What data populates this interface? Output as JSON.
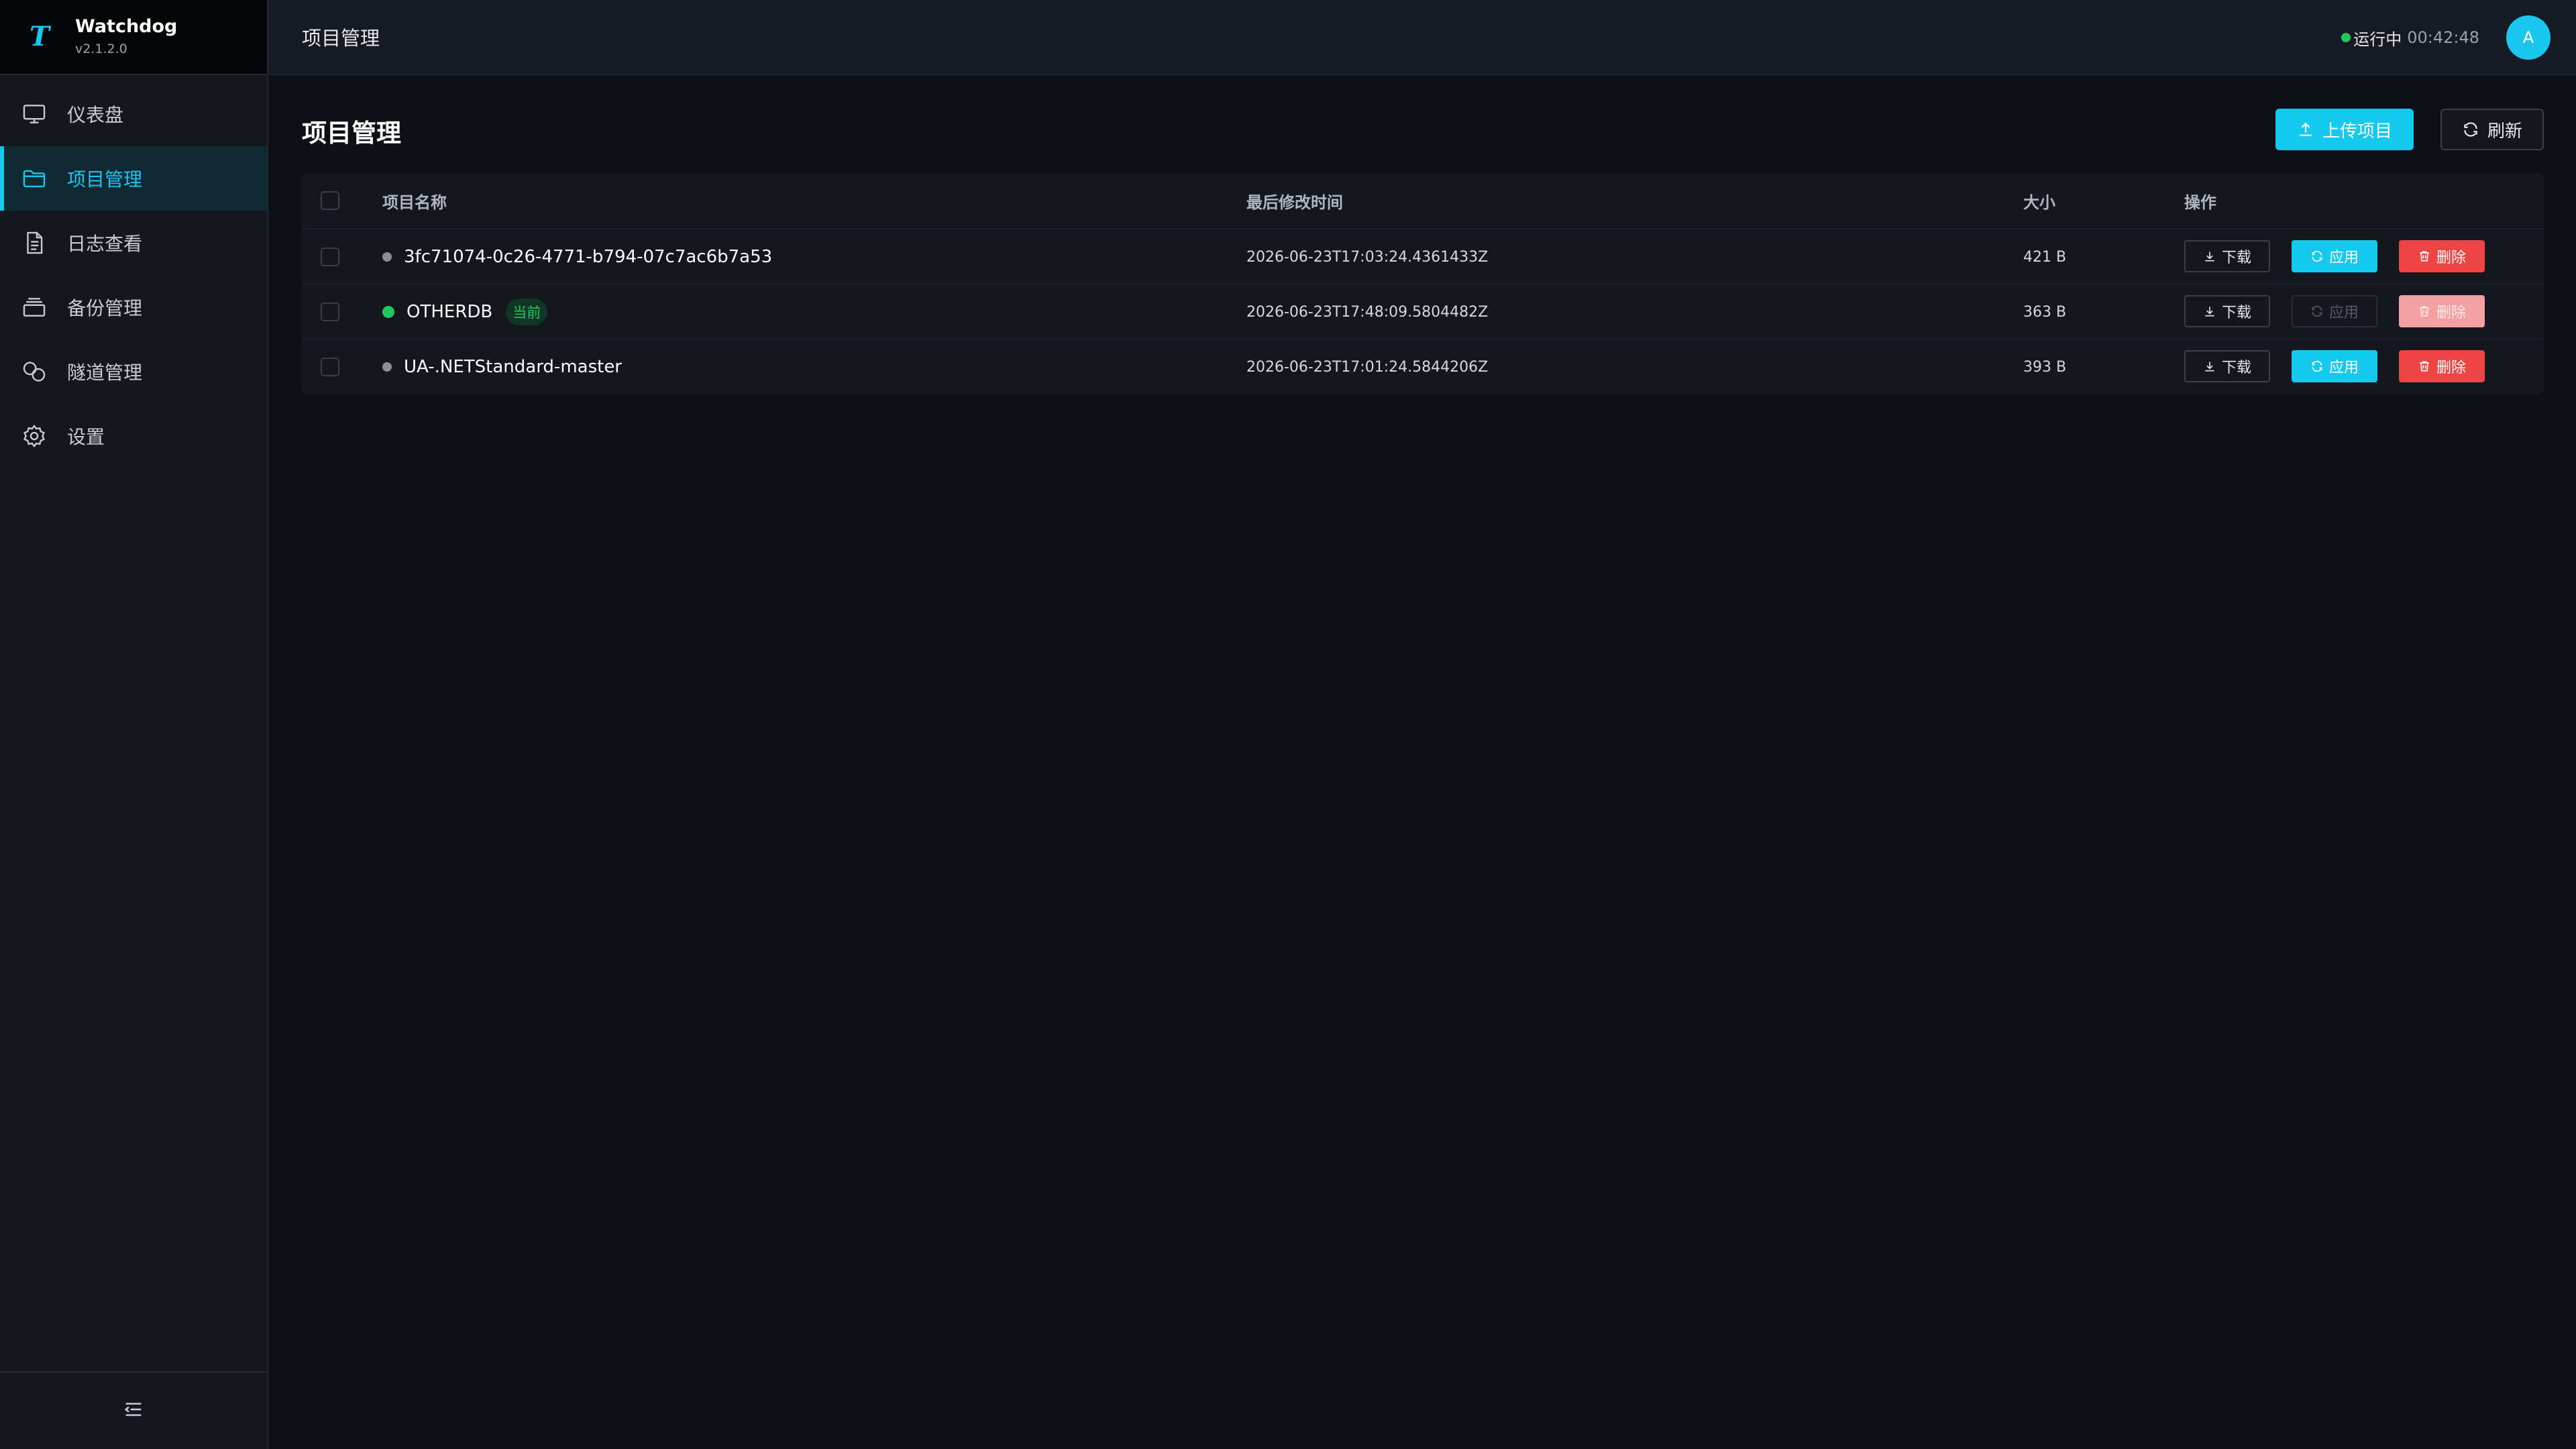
{
  "brand": {
    "name": "Watchdog",
    "version": "v2.1.2.0",
    "logo": "T"
  },
  "sidebar": {
    "items": [
      {
        "label": "仪表盘",
        "icon": "monitor-icon",
        "active": false
      },
      {
        "label": "项目管理",
        "icon": "folder-icon",
        "active": true
      },
      {
        "label": "日志查看",
        "icon": "document-icon",
        "active": false
      },
      {
        "label": "备份管理",
        "icon": "layers-icon",
        "active": false
      },
      {
        "label": "隧道管理",
        "icon": "link-icon",
        "active": false
      },
      {
        "label": "设置",
        "icon": "gear-icon",
        "active": false
      }
    ],
    "collapse_icon": "menu-fold-icon"
  },
  "topbar": {
    "title": "项目管理",
    "status": "运行中",
    "uptime": "00:42:48",
    "avatar": "A"
  },
  "page": {
    "title": "项目管理",
    "upload_label": "上传项目",
    "refresh_label": "刷新"
  },
  "table": {
    "headers": {
      "name": "项目名称",
      "modified": "最后修改时间",
      "size": "大小",
      "actions": "操作"
    },
    "rows": [
      {
        "name": "3fc71074-0c26-4771-b794-07c7ac6b7a53",
        "current": false,
        "modified": "2026-06-23T17:03:24.4361433Z",
        "size": "421 B"
      },
      {
        "name": "OTHERDB",
        "current": true,
        "current_tag": "当前",
        "modified": "2026-06-23T17:48:09.5804482Z",
        "size": "363 B"
      },
      {
        "name": "UA-.NETStandard-master",
        "current": false,
        "modified": "2026-06-23T17:01:24.5844206Z",
        "size": "393 B"
      }
    ],
    "actions": {
      "download": "下载",
      "apply": "应用",
      "delete": "删除"
    }
  },
  "colors": {
    "accent": "#14c8ee",
    "success": "#22c55e",
    "danger": "#ef4444"
  }
}
